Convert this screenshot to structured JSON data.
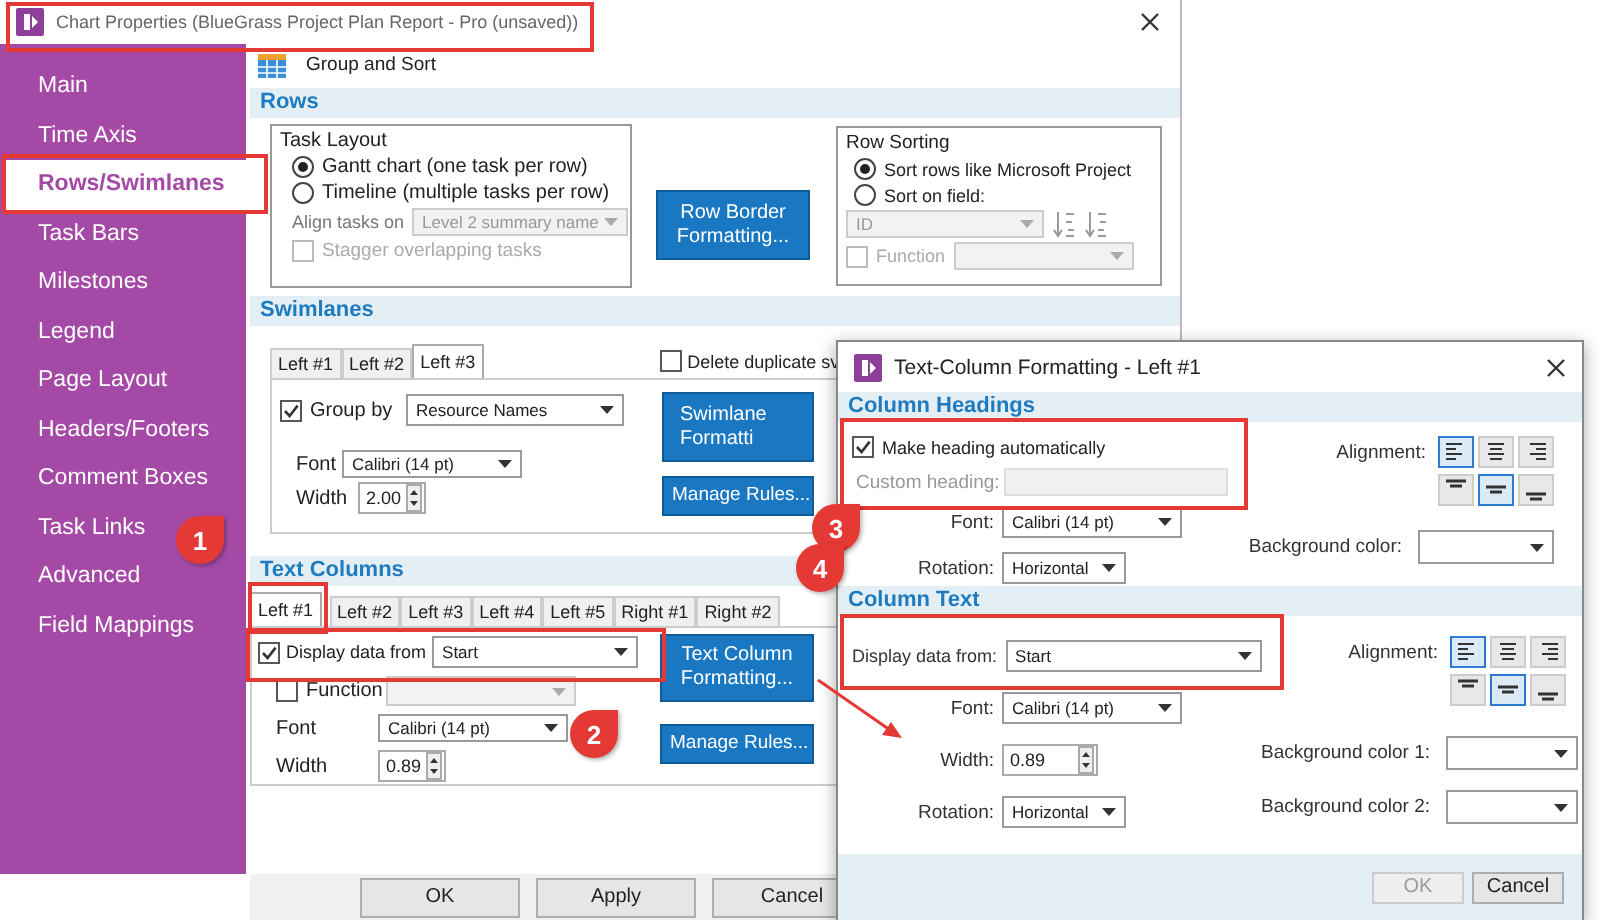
{
  "window": {
    "title": "Chart Properties (BlueGrass Project Plan Report - Pro (unsaved))"
  },
  "sidebar": {
    "items": [
      {
        "label": "Main",
        "selected": false
      },
      {
        "label": "Time Axis",
        "selected": false
      },
      {
        "label": "Rows/Swimlanes",
        "selected": true
      },
      {
        "label": "Task Bars",
        "selected": false
      },
      {
        "label": "Milestones",
        "selected": false
      },
      {
        "label": "Legend",
        "selected": false
      },
      {
        "label": "Page Layout",
        "selected": false
      },
      {
        "label": "Headers/Footers",
        "selected": false
      },
      {
        "label": "Comment Boxes",
        "selected": false
      },
      {
        "label": "Task Links",
        "selected": false
      },
      {
        "label": "Advanced",
        "selected": false
      },
      {
        "label": "Field Mappings",
        "selected": false
      }
    ]
  },
  "page_header": {
    "title": "Group and Sort"
  },
  "rows": {
    "title": "Rows",
    "task_layout": {
      "title": "Task Layout",
      "options": [
        {
          "label": "Gantt chart (one task per row)",
          "selected": true
        },
        {
          "label": "Timeline (multiple tasks per row)",
          "selected": false
        }
      ],
      "align_label": "Align tasks on",
      "align_value": "Level 2 summary name",
      "stagger": {
        "label": "Stagger overlapping tasks",
        "checked": false,
        "disabled": true
      }
    },
    "border_button": "Row Border Formatting...",
    "row_sorting": {
      "title": "Row Sorting",
      "options": [
        {
          "label": "Sort rows like Microsoft Project",
          "selected": true
        },
        {
          "label": "Sort on field:",
          "selected": false
        }
      ],
      "field_value": "ID",
      "function": {
        "label": "Function",
        "checked": false,
        "disabled": true
      }
    }
  },
  "swimlanes": {
    "title": "Swimlanes",
    "tabs": [
      {
        "label": "Left #1",
        "selected": false
      },
      {
        "label": "Left #2",
        "selected": false
      },
      {
        "label": "Left #3",
        "selected": true
      }
    ],
    "delete_duplicates": {
      "label": "Delete duplicate sv",
      "checked": false
    },
    "group_by": {
      "label": "Group by",
      "checked": true,
      "value": "Resource Names"
    },
    "font": {
      "label": "Font",
      "value": "Calibri (14 pt)"
    },
    "width": {
      "label": "Width",
      "value": "2.00"
    },
    "buttons": [
      "Swimlane Formatti",
      "Manage Rules..."
    ]
  },
  "text_columns": {
    "title": "Text Columns",
    "tabs": [
      {
        "label": "Left #1",
        "selected": true
      },
      {
        "label": "Left #2",
        "selected": false
      },
      {
        "label": "Left #3",
        "selected": false
      },
      {
        "label": "Left #4",
        "selected": false
      },
      {
        "label": "Left #5",
        "selected": false
      },
      {
        "label": "Right #1",
        "selected": false
      },
      {
        "label": "Right #2",
        "selected": false
      }
    ],
    "display_data": {
      "label": "Display data from",
      "checked": true,
      "value": "Start"
    },
    "function": {
      "label": "Function",
      "checked": false
    },
    "font": {
      "label": "Font",
      "value": "Calibri (14 pt)"
    },
    "width": {
      "label": "Width",
      "value": "0.89"
    },
    "buttons": [
      "Text Column Formatting...",
      "Manage Rules..."
    ]
  },
  "footer_buttons": [
    "OK",
    "Apply",
    "Cancel"
  ],
  "dialog": {
    "title": "Text-Column Formatting - Left #1",
    "column_headings": {
      "title": "Column Headings",
      "make_heading": {
        "label": "Make heading automatically",
        "checked": true
      },
      "custom_heading_label": "Custom heading:",
      "font": {
        "label": "Font:",
        "value": "Calibri (14 pt)"
      },
      "rotation": {
        "label": "Rotation:",
        "value": "Horizontal"
      },
      "alignment_label": "Alignment:",
      "alignment": [
        {
          "kind": "left",
          "selected": true
        },
        {
          "kind": "center",
          "selected": false
        },
        {
          "kind": "right",
          "selected": false
        },
        {
          "kind": "top",
          "selected": false
        },
        {
          "kind": "middle",
          "selected": true
        },
        {
          "kind": "bottom",
          "selected": false
        }
      ],
      "background": {
        "label": "Background color:"
      }
    },
    "column_text": {
      "title": "Column Text",
      "display_data": {
        "label": "Display data from:",
        "value": "Start"
      },
      "font": {
        "label": "Font:",
        "value": "Calibri (14 pt)"
      },
      "width": {
        "label": "Width:",
        "value": "0.89"
      },
      "rotation": {
        "label": "Rotation:",
        "value": "Horizontal"
      },
      "alignment_label": "Alignment:",
      "alignment": [
        {
          "kind": "left",
          "selected": true
        },
        {
          "kind": "center",
          "selected": false
        },
        {
          "kind": "right",
          "selected": false
        },
        {
          "kind": "top",
          "selected": false
        },
        {
          "kind": "middle",
          "selected": true
        },
        {
          "kind": "bottom",
          "selected": false
        }
      ],
      "background_1": {
        "label": "Background color 1:"
      },
      "background_2": {
        "label": "Background color 2:"
      }
    },
    "buttons": [
      {
        "label": "OK",
        "disabled": true
      },
      {
        "label": "Cancel",
        "disabled": false
      }
    ]
  },
  "annotations": [
    {
      "label": "1"
    },
    {
      "label": "2"
    },
    {
      "label": "3"
    },
    {
      "label": "4"
    }
  ]
}
